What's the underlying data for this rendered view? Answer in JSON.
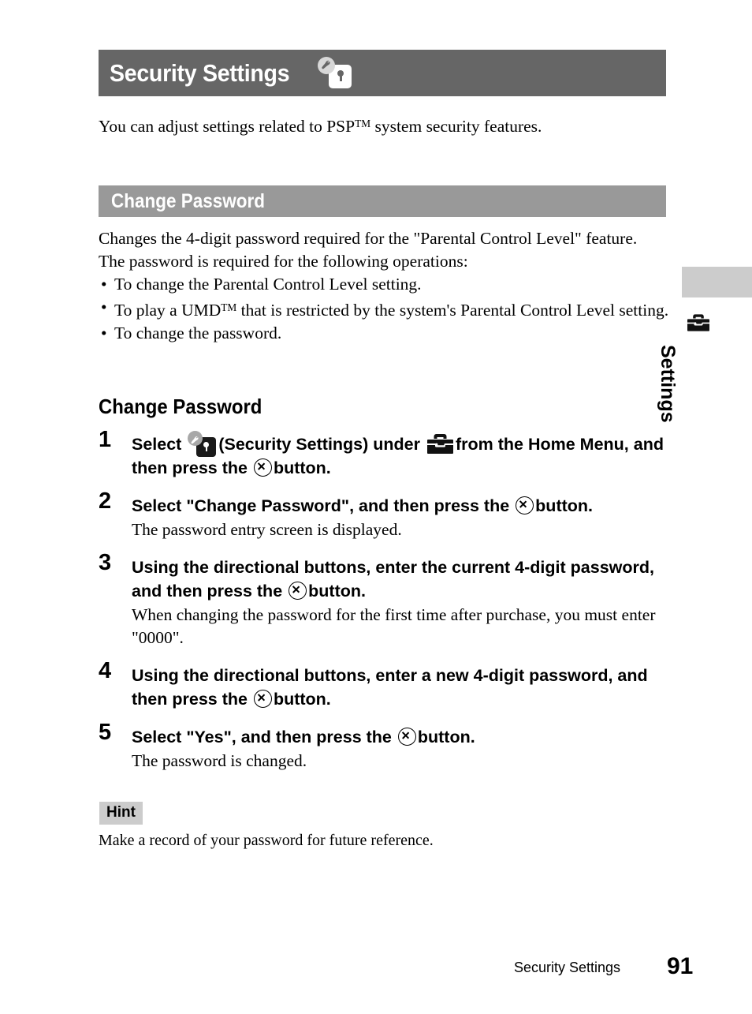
{
  "page": {
    "title": "Security Settings",
    "title_icon": "security-settings-icon",
    "intro": "You can adjust settings related to PSP™ system security features.",
    "intro_parts": {
      "before": "You can adjust settings related to PSP",
      "trademark": "TM",
      "after": " system security features."
    }
  },
  "section": {
    "heading": "Change Password",
    "description_line1": "Changes the 4-digit password required for the \"Parental Control Level\" feature.",
    "description_line2": "The password is required for the following operations:",
    "bullets": [
      {
        "marker": "•",
        "before": "To change the Parental Control Level setting.",
        "trademark": "",
        "after": ""
      },
      {
        "marker": "•",
        "before": "To play a UMD",
        "trademark": "TM",
        "after": " that is restricted by the system's Parental Control Level setting."
      },
      {
        "marker": "•",
        "before": "To change the password.",
        "trademark": "",
        "after": ""
      }
    ]
  },
  "procedure": {
    "heading": "Change Password",
    "steps": [
      {
        "number": "1",
        "text_a": "Select",
        "icon_a": "security-settings-icon",
        "text_b": "(Security Settings) under",
        "icon_b": "toolbox-icon",
        "text_c": "from the Home Menu, and then press the",
        "icon_c": "cross-button-icon",
        "text_d": "button.",
        "sub": ""
      },
      {
        "number": "2",
        "text_a": "Select \"Change Password\", and then press the",
        "icon_c": "cross-button-icon",
        "text_d": "button.",
        "sub": "The password entry screen is displayed."
      },
      {
        "number": "3",
        "text_a": "Using the directional buttons, enter the current 4-digit password, and then press the",
        "icon_c": "cross-button-icon",
        "text_d": "button.",
        "sub": "When changing the password for the first time after purchase, you must enter \"0000\"."
      },
      {
        "number": "4",
        "text_a": "Using the directional buttons, enter a new 4-digit password, and then press the",
        "icon_c": "cross-button-icon",
        "text_d": "button.",
        "sub": ""
      },
      {
        "number": "5",
        "text_a": "Select \"Yes\", and then press the",
        "icon_c": "cross-button-icon",
        "text_d": "button.",
        "sub": "The password is changed."
      }
    ]
  },
  "hint": {
    "label": "Hint",
    "text": "Make a record of your password for future reference."
  },
  "side_tab": {
    "label": "Settings",
    "icon": "toolbox-icon"
  },
  "footer": {
    "section_name": "Security Settings",
    "page_number": "91"
  },
  "colors": {
    "title_bar": "#666666",
    "section_bar": "#999999",
    "hint_badge": "#cccccc",
    "side_tab_block": "#cccccc",
    "text": "#000000",
    "page_background": "#ffffff"
  }
}
